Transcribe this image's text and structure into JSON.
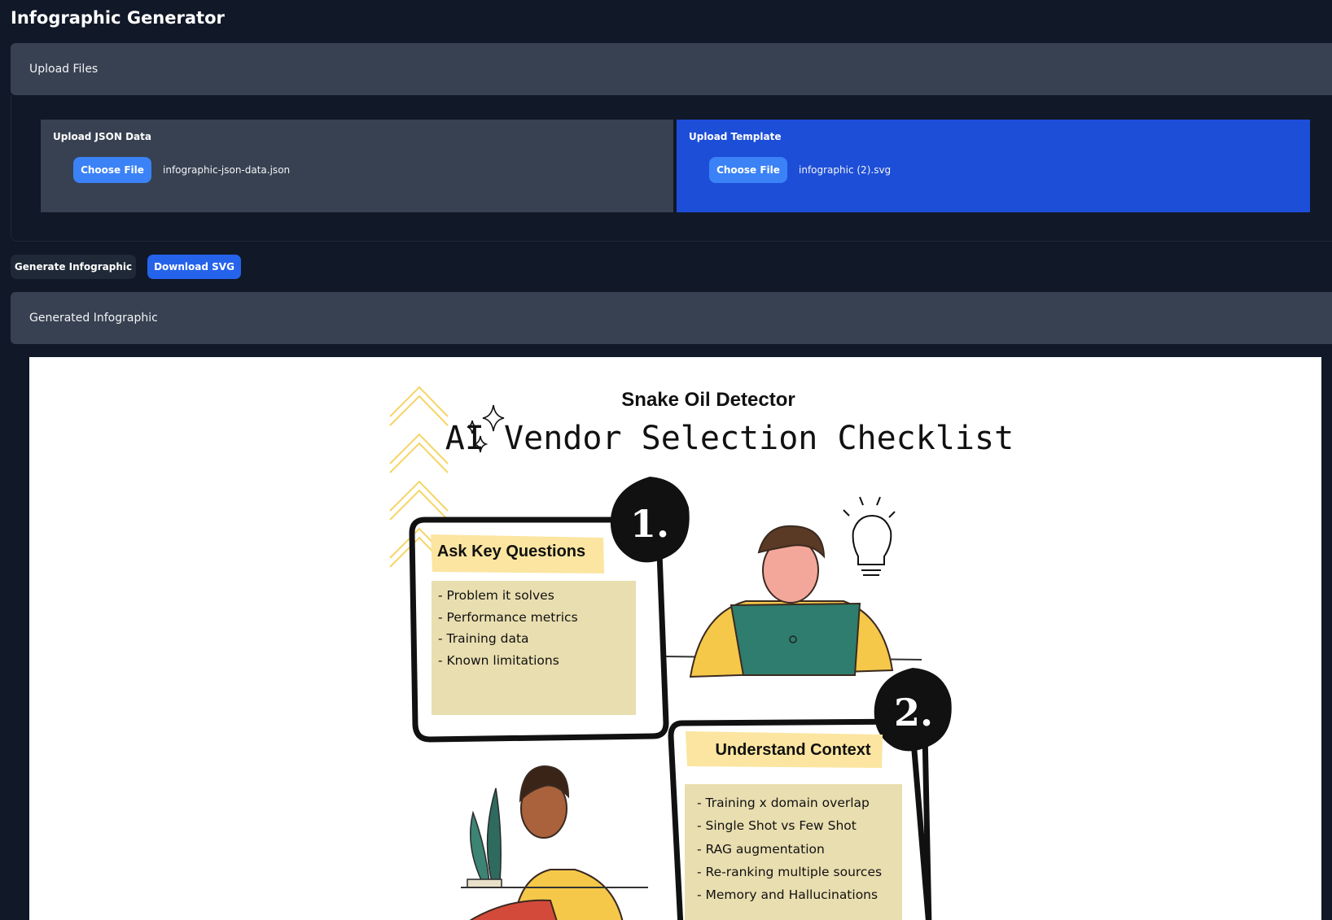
{
  "app": {
    "title": "Infographic Generator"
  },
  "upload_section": {
    "header": "Upload Files",
    "json_card": {
      "label": "Upload JSON Data",
      "button": "Choose File",
      "file_name": "infographic-json-data.json"
    },
    "template_card": {
      "label": "Upload Template",
      "button": "Choose File",
      "file_name": "infographic (2).svg"
    }
  },
  "actions": {
    "generate_label": "Generate Infographic",
    "download_label": "Download SVG"
  },
  "generated_section": {
    "header": "Generated Infographic"
  },
  "infographic": {
    "subtitle": "Snake Oil Detector",
    "title": "AI Vendor Selection Checklist",
    "step1": {
      "number": "1.",
      "heading": "Ask Key Questions",
      "items": [
        "- Problem it solves",
        "- Performance metrics",
        "- Training data",
        "- Known limitations"
      ]
    },
    "step2": {
      "number": "2.",
      "heading": "Understand Context",
      "items": [
        "- Training x domain overlap",
        "- Single Shot vs Few Shot",
        "- RAG augmentation",
        "- Re-ranking multiple sources",
        "- Memory and Hallucinations"
      ]
    }
  }
}
